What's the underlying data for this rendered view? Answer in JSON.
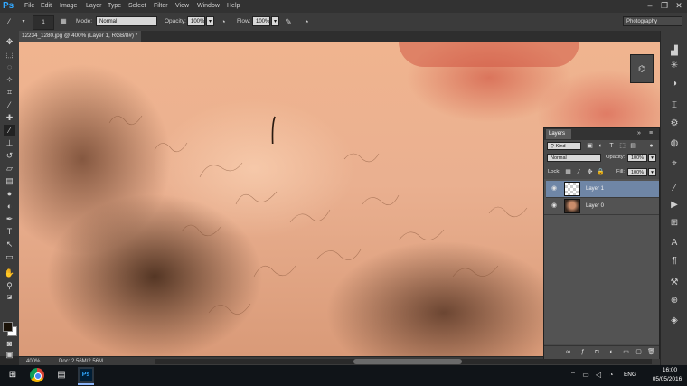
{
  "app": {
    "logo": "Ps"
  },
  "menu": [
    "File",
    "Edit",
    "Image",
    "Layer",
    "Type",
    "Select",
    "Filter",
    "View",
    "Window",
    "Help"
  ],
  "window_controls": {
    "minimize": "–",
    "restore": "❐",
    "close": "✕"
  },
  "options_bar": {
    "brush_size": "1",
    "mode_label": "Mode:",
    "mode_value": "Normal",
    "opacity_label": "Opacity:",
    "opacity_value": "100%",
    "flow_label": "Flow:",
    "flow_value": "100%",
    "workspace": "Photography"
  },
  "document": {
    "tab_title": "12234_1280.jpg @ 400% (Layer 1, RGB/8#) *",
    "tab_close": "×",
    "zoom": "400%",
    "doc_size": "Doc: 2.56M/2.56M"
  },
  "layers_panel": {
    "title": "Layers",
    "filter_kind": "Kind",
    "blend_mode": "Normal",
    "opacity_label": "Opacity:",
    "opacity_value": "100%",
    "lock_label": "Lock:",
    "fill_label": "Fill:",
    "fill_value": "100%",
    "layers": [
      {
        "name": "Layer 1",
        "selected": true,
        "visible": true
      },
      {
        "name": "Layer 0",
        "selected": false,
        "visible": true
      }
    ]
  },
  "taskbar": {
    "clock_time": "16:00",
    "clock_date": "05/05/2016",
    "language": "ENG"
  },
  "colors": {
    "foreground": "#1a1208",
    "background": "#ffffff",
    "accent": "#31a8ff",
    "selected_layer": "#6f86a6"
  }
}
